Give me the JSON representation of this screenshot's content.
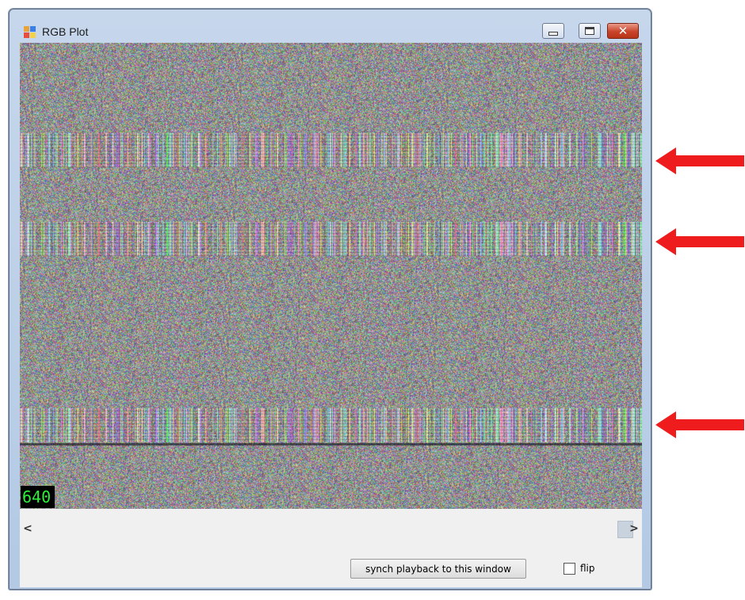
{
  "window": {
    "title": "RGB Plot",
    "close_glyph": "✕",
    "icons": [
      "app-icon",
      "minimize-icon",
      "maximize-icon",
      "close-icon"
    ]
  },
  "plot": {
    "frame_counter": "640",
    "counter_color": "#2df03a",
    "band_rows": [
      0.23,
      0.42,
      0.82
    ],
    "dark_line_row": 0.86
  },
  "scrollbar": {
    "left_arrow": "<",
    "right_arrow": ">",
    "position": 1.0
  },
  "controls": {
    "sync_button_label": "synch playback to this window",
    "flip_label": "flip",
    "flip_checked": false
  },
  "annotations": {
    "arrow_color": "#ee1c1c",
    "arrow_count": 3
  }
}
